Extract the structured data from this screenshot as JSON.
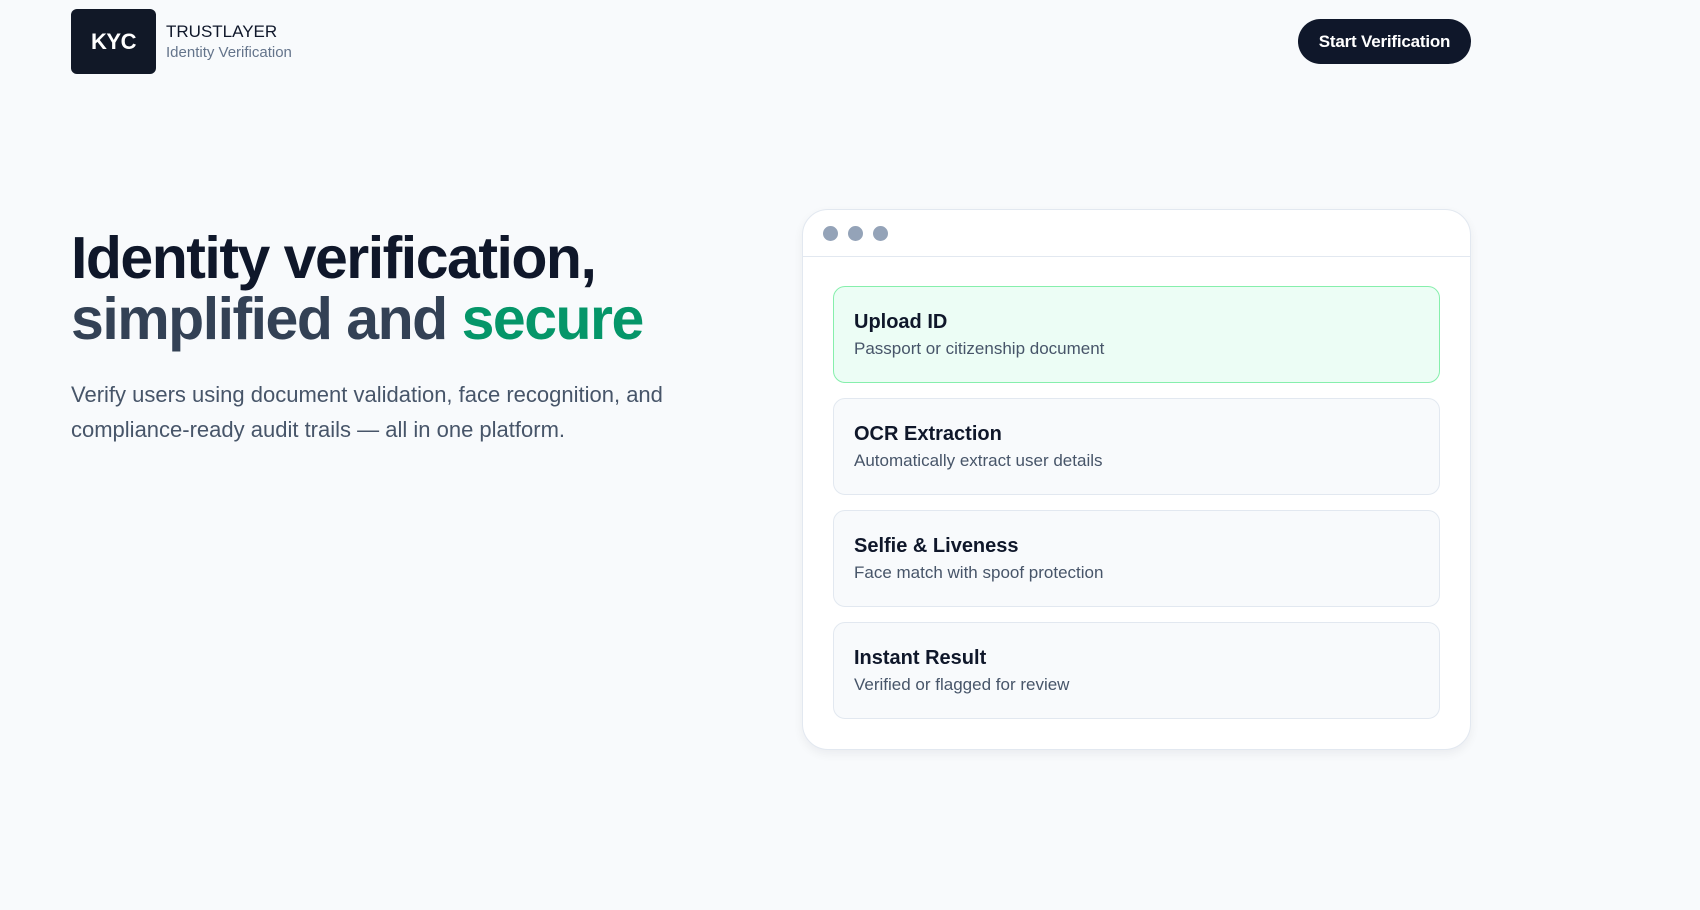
{
  "header": {
    "logo_text": "KYC",
    "brand_name": "TRUSTLAYER",
    "brand_subtitle": "Identity Verification",
    "cta_label": "Start Verification"
  },
  "hero": {
    "title_line1": "Identity verification,",
    "title_line2_start": "simplified and ",
    "title_line2_accent": "secure",
    "description": "Verify users using document validation, face recognition, and compliance-ready audit trails — all in one platform."
  },
  "colors": {
    "accent": "#059669",
    "dark": "#0f172a",
    "active_step_bg": "#ecfdf5",
    "active_step_border": "#86efac"
  },
  "panel": {
    "steps": [
      {
        "title": "Upload ID",
        "subtitle": "Passport or citizenship document",
        "active": true
      },
      {
        "title": "OCR Extraction",
        "subtitle": "Automatically extract user details",
        "active": false
      },
      {
        "title": "Selfie & Liveness",
        "subtitle": "Face match with spoof protection",
        "active": false
      },
      {
        "title": "Instant Result",
        "subtitle": "Verified or flagged for review",
        "active": false
      }
    ]
  }
}
